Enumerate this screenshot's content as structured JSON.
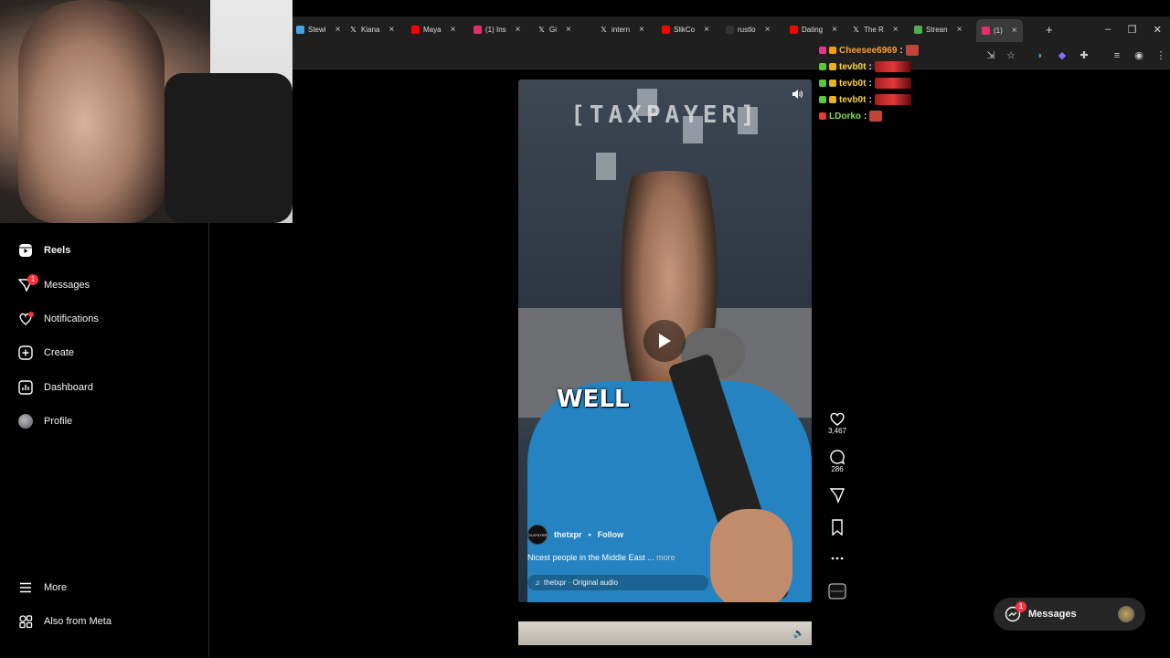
{
  "browser": {
    "tabs": [
      {
        "label": "Stewi",
        "icon": "edge-icon",
        "color": "#4aa3df"
      },
      {
        "label": "Kiana",
        "icon": "x-icon",
        "color": "#ffffff"
      },
      {
        "label": "Maya",
        "icon": "youtube-icon",
        "color": "#ff0000"
      },
      {
        "label": "(1) Ins",
        "icon": "instagram-icon",
        "color": "#e1306c"
      },
      {
        "label": "Gi",
        "icon": "x-icon",
        "color": "#ffffff"
      },
      {
        "label": "intern",
        "icon": "x-icon",
        "color": "#ffffff"
      },
      {
        "label": "SlikCo",
        "icon": "youtube-icon",
        "color": "#ff0000"
      },
      {
        "label": "rustlo",
        "icon": "page-icon",
        "color": "#333333"
      },
      {
        "label": "Dating",
        "icon": "youtube-icon",
        "color": "#ff0000"
      },
      {
        "label": "The R",
        "icon": "x-icon",
        "color": "#ffffff"
      },
      {
        "label": "Strean",
        "icon": "bar-chart-icon",
        "color": "#4caf50"
      },
      {
        "label": "(1)",
        "icon": "instagram-icon",
        "color": "#e1306c",
        "active": true
      }
    ],
    "new_tab": "+",
    "window_controls": [
      "–",
      "❐",
      "✕"
    ]
  },
  "chat": [
    {
      "user": "Cheesee6969",
      "color": "#ff9e2c",
      "badges": [
        "#e23a8a",
        "#f0a000"
      ],
      "emote": "small"
    },
    {
      "user": "tevb0t",
      "color": "#f7d23a",
      "badges": [
        "#59c93c",
        "#e8b026"
      ],
      "emote": "wide"
    },
    {
      "user": "tevb0t",
      "color": "#f7d23a",
      "badges": [
        "#59c93c",
        "#e8b026"
      ],
      "emote": "wide"
    },
    {
      "user": "tevb0t",
      "color": "#f7d23a",
      "badges": [
        "#59c93c",
        "#e8b026"
      ],
      "emote": "wide"
    },
    {
      "user": "LDorko",
      "color": "#7ce04a",
      "badges": [
        "#e23a3a"
      ],
      "emote": "small"
    }
  ],
  "chat_separator": ":",
  "sidebar": {
    "items": [
      {
        "label": "Reels",
        "icon": "reels-icon",
        "active": true
      },
      {
        "label": "Messages",
        "icon": "messages-icon",
        "badge": "1"
      },
      {
        "label": "Notifications",
        "icon": "heart-icon",
        "dot": true
      },
      {
        "label": "Create",
        "icon": "plus-square-icon"
      },
      {
        "label": "Dashboard",
        "icon": "dashboard-icon"
      },
      {
        "label": "Profile",
        "icon": "avatar"
      }
    ],
    "bottom_items": [
      {
        "label": "More",
        "icon": "hamburger-icon"
      },
      {
        "label": "Also from Meta",
        "icon": "meta-apps-icon"
      }
    ]
  },
  "reel": {
    "watermark": "[TAXPAYER]",
    "caption_word": "WELL",
    "author": "thetxpr",
    "author_avatar_text": "TAXPAYER",
    "follow_label": "Follow",
    "separator": "•",
    "description": "Nicest people in the Middle East ...",
    "more_label": "more",
    "audio": "thetxpr · Original audio"
  },
  "actions": {
    "likes": "3,467",
    "comments": "286"
  },
  "messages_pill": {
    "label": "Messages",
    "badge": "1"
  }
}
